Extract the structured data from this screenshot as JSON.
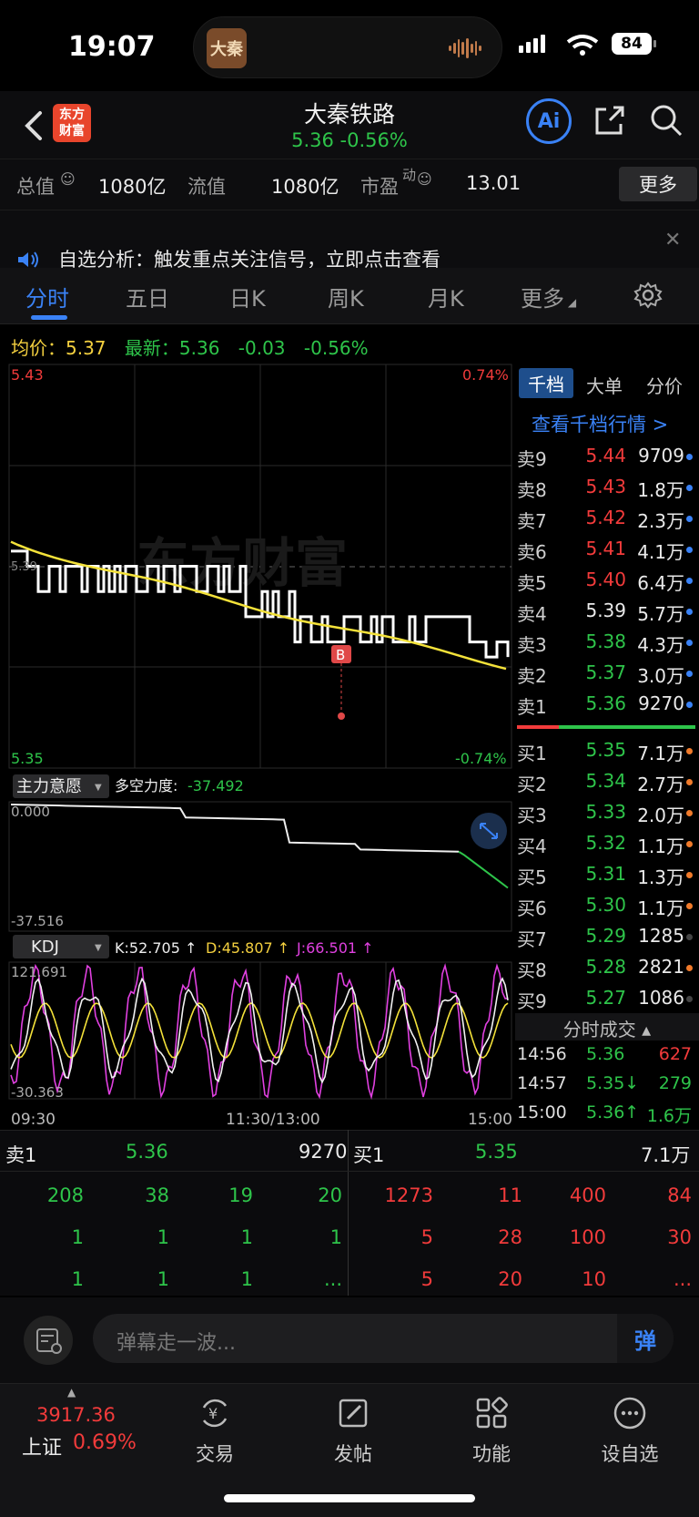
{
  "status_bar": {
    "time": "19:07",
    "battery": "84",
    "island_app": "大秦"
  },
  "header": {
    "logo": "东方\n财富",
    "title": "大秦铁路",
    "price": "5.36  -0.56%",
    "ai_label": "Ai"
  },
  "stats": {
    "total_cap_label": "总值",
    "total_cap_value": "1080亿",
    "float_cap_label": "流值",
    "float_cap_value": "1080亿",
    "pe_label": "市盈",
    "pe_sup": "动",
    "pe_value": "13.01",
    "more_label": "更多"
  },
  "alert": {
    "text": "自选分析：触发重点关注信号，立即点击查看"
  },
  "tabs": [
    "分时",
    "五日",
    "日K",
    "周K",
    "月K",
    "更多"
  ],
  "quote_line": {
    "avg_label": "均价：",
    "avg_value": "5.37",
    "latest_label": "最新：",
    "latest_value": "5.36",
    "change": "-0.03",
    "pct": "-0.56%"
  },
  "chart_labels": {
    "price_high": "5.43",
    "pct_high": "0.74%",
    "price_low": "5.35",
    "pct_low": "-0.74%",
    "prev_close": "5.39",
    "watermark": "东方财富",
    "b_marker": "B",
    "force_label": "主力意愿",
    "force_strength_label": "多空力度:",
    "force_strength_value": "-37.492",
    "force_top": "0.000",
    "force_bottom": "-37.516",
    "kdj_label": "KDJ",
    "kdj_k": "K:52.705 ↑",
    "kdj_d": "D:45.807 ↑",
    "kdj_j": "J:66.501 ↑",
    "kdj_top": "121.691",
    "kdj_bottom": "-30.363",
    "time_start": "09:30",
    "time_mid": "11:30/13:00",
    "time_end": "15:00"
  },
  "chart_data": {
    "type": "line",
    "title": "",
    "x_range": [
      "09:30",
      "15:00"
    ],
    "ylim": [
      5.35,
      5.43
    ],
    "prev_close": 5.39,
    "avg_price_series": {
      "name": "均价",
      "start": 5.395,
      "end": 5.37
    },
    "latest_price": 5.36
  },
  "order_book": {
    "tabs": [
      "千档",
      "大单",
      "分价"
    ],
    "link": "查看千档行情 >",
    "asks": [
      {
        "label": "卖9",
        "price": "5.44",
        "vol": "9709",
        "color": "#f23b3b",
        "dot": "#3a82f6"
      },
      {
        "label": "卖8",
        "price": "5.43",
        "vol": "1.8万",
        "color": "#f23b3b",
        "dot": "#3a82f6"
      },
      {
        "label": "卖7",
        "price": "5.42",
        "vol": "2.3万",
        "color": "#f23b3b",
        "dot": "#3a82f6"
      },
      {
        "label": "卖6",
        "price": "5.41",
        "vol": "4.1万",
        "color": "#f23b3b",
        "dot": "#3a82f6"
      },
      {
        "label": "卖5",
        "price": "5.40",
        "vol": "6.4万",
        "color": "#f23b3b",
        "dot": "#3a82f6"
      },
      {
        "label": "卖4",
        "price": "5.39",
        "vol": "5.7万",
        "color": "#eaeaea",
        "dot": "#3a82f6"
      },
      {
        "label": "卖3",
        "price": "5.38",
        "vol": "4.3万",
        "color": "#2ec44a",
        "dot": "#3a82f6"
      },
      {
        "label": "卖2",
        "price": "5.37",
        "vol": "3.0万",
        "color": "#2ec44a",
        "dot": "#3a82f6"
      },
      {
        "label": "卖1",
        "price": "5.36",
        "vol": "9270",
        "color": "#2ec44a",
        "dot": "#3a82f6"
      }
    ],
    "bids": [
      {
        "label": "买1",
        "price": "5.35",
        "vol": "7.1万",
        "color": "#2ec44a",
        "dot": "#f07a2a"
      },
      {
        "label": "买2",
        "price": "5.34",
        "vol": "2.7万",
        "color": "#2ec44a",
        "dot": "#f07a2a"
      },
      {
        "label": "买3",
        "price": "5.33",
        "vol": "2.0万",
        "color": "#2ec44a",
        "dot": "#f07a2a"
      },
      {
        "label": "买4",
        "price": "5.32",
        "vol": "1.1万",
        "color": "#2ec44a",
        "dot": "#f07a2a"
      },
      {
        "label": "买5",
        "price": "5.31",
        "vol": "1.3万",
        "color": "#2ec44a",
        "dot": "#f07a2a"
      },
      {
        "label": "买6",
        "price": "5.30",
        "vol": "1.1万",
        "color": "#2ec44a",
        "dot": "#f07a2a"
      },
      {
        "label": "买7",
        "price": "5.29",
        "vol": "1285",
        "color": "#2ec44a",
        "dot": "#444"
      },
      {
        "label": "买8",
        "price": "5.28",
        "vol": "2821",
        "color": "#2ec44a",
        "dot": "#f07a2a"
      },
      {
        "label": "买9",
        "price": "5.27",
        "vol": "1086",
        "color": "#2ec44a",
        "dot": "#444"
      }
    ]
  },
  "ticks": {
    "header": "分时成交 ▴",
    "rows": [
      {
        "time": "14:56",
        "price": "5.36",
        "vol": "627",
        "pcolor": "#2ec44a",
        "vcolor": "#f23b3b"
      },
      {
        "time": "14:57",
        "price": "5.35↓",
        "vol": "279",
        "pcolor": "#2ec44a",
        "vcolor": "#2ec44a"
      },
      {
        "time": "15:00",
        "price": "5.36↑",
        "vol": "1.6万",
        "pcolor": "#2ec44a",
        "vcolor": "#2ec44a"
      }
    ]
  },
  "level1": {
    "sell": {
      "label": "卖1",
      "price": "5.36",
      "vol": "9270"
    },
    "buy": {
      "label": "买1",
      "price": "5.35",
      "vol": "7.1万"
    },
    "sell_queue": [
      [
        "208",
        "38",
        "19",
        "20"
      ],
      [
        "1",
        "1",
        "1",
        "1"
      ],
      [
        "1",
        "1",
        "1",
        "..."
      ]
    ],
    "buy_queue": [
      [
        "1273",
        "11",
        "400",
        "84"
      ],
      [
        "5",
        "28",
        "100",
        "30"
      ],
      [
        "5",
        "20",
        "10",
        "..."
      ]
    ]
  },
  "comment": {
    "placeholder": "弹幕走一波...",
    "danmu": "弹"
  },
  "bottom_nav": {
    "index_value": "3917.36",
    "index_name": "上证",
    "index_pct": "0.69%",
    "items": [
      "交易",
      "发帖",
      "功能",
      "设自选"
    ]
  }
}
